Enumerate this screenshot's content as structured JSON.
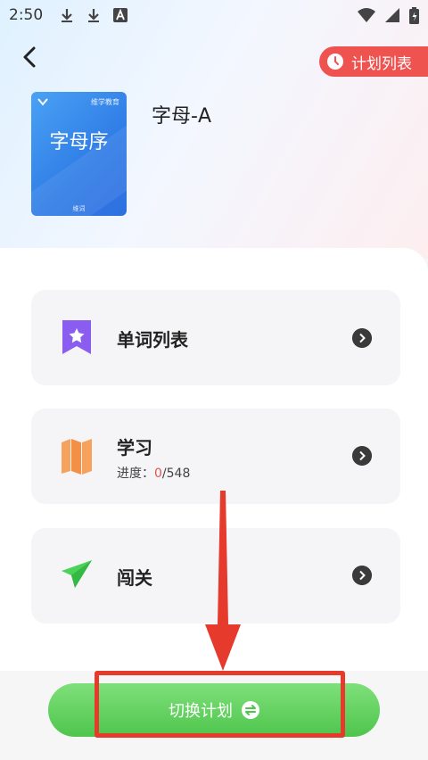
{
  "status_bar": {
    "time": "2:50",
    "left_icons": [
      "download-icon",
      "download-icon",
      "font-a-icon"
    ],
    "right_icons": [
      "wifi-icon",
      "signal-icon",
      "battery-icon"
    ]
  },
  "header": {
    "back_icon": "chevron-left-icon",
    "plan_list_label": "计划列表",
    "plan_list_icon": "clock-icon"
  },
  "book": {
    "publisher": "维学教育",
    "title": "字母序",
    "footer": "维词",
    "color": "#3b8cf0"
  },
  "plan_title": "字母-A",
  "cards": [
    {
      "label": "单词列表",
      "icon": "bookmark-star-icon"
    },
    {
      "label": "学习",
      "icon": "map-icon",
      "progress_prefix": "进度：",
      "progress_done": "0",
      "progress_total": "/548"
    },
    {
      "label": "闯关",
      "icon": "paper-plane-icon"
    }
  ],
  "switch_button": {
    "label": "切换计划",
    "icon": "swap-icon"
  },
  "colors": {
    "accent_red": "#ef5350",
    "button_green": "#5ccb58",
    "annotation_red": "#e53a2c"
  }
}
